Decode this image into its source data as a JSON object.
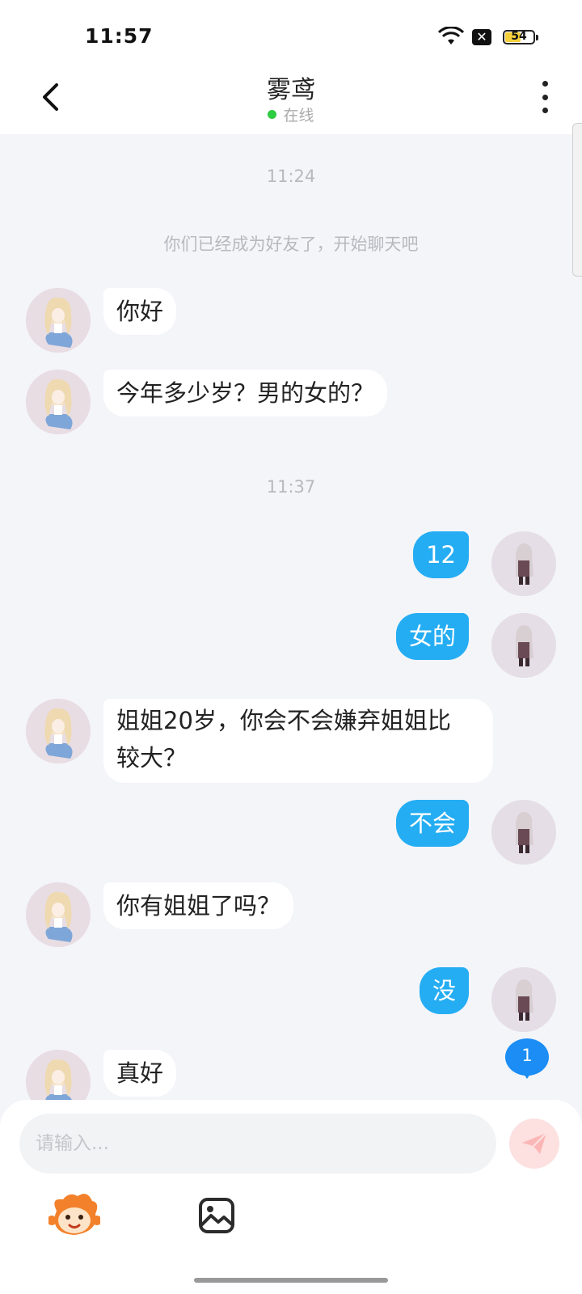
{
  "status_bar": {
    "time": "11:57",
    "battery": "54",
    "icons": [
      "wifi-icon",
      "sim-x-icon",
      "battery-icon"
    ]
  },
  "header": {
    "title": "雾鸢",
    "status": "在线",
    "back_icon": "chevron-left-icon",
    "more_icon": "more-vertical-icon"
  },
  "chat": {
    "timestamp_1": "11:24",
    "system_notice": "你们已经成为好友了，开始聊天吧",
    "timestamp_2": "11:37",
    "messages": [
      {
        "side": "left",
        "text": "你好"
      },
      {
        "side": "left",
        "text": "今年多少岁？男的女的？"
      },
      {
        "side": "right",
        "text": "12"
      },
      {
        "side": "right",
        "text": "女的"
      },
      {
        "side": "left",
        "text": "姐姐20岁，你会不会嫌弃姐姐比\n较大？"
      },
      {
        "side": "right",
        "text": "不会"
      },
      {
        "side": "left",
        "text": "你有姐姐了吗？"
      },
      {
        "side": "right",
        "text": "没"
      },
      {
        "side": "left",
        "text": "真好"
      }
    ],
    "unread_count": "1"
  },
  "composer": {
    "placeholder": "请输入...",
    "value": "",
    "send_icon": "send-icon",
    "emoji_icon": "monkey-emoji-icon",
    "image_icon": "image-icon"
  },
  "colors": {
    "accent": "#25adf3",
    "badge": "#1b8df4",
    "online": "#2ecc40",
    "background": "#f4f5f9"
  }
}
